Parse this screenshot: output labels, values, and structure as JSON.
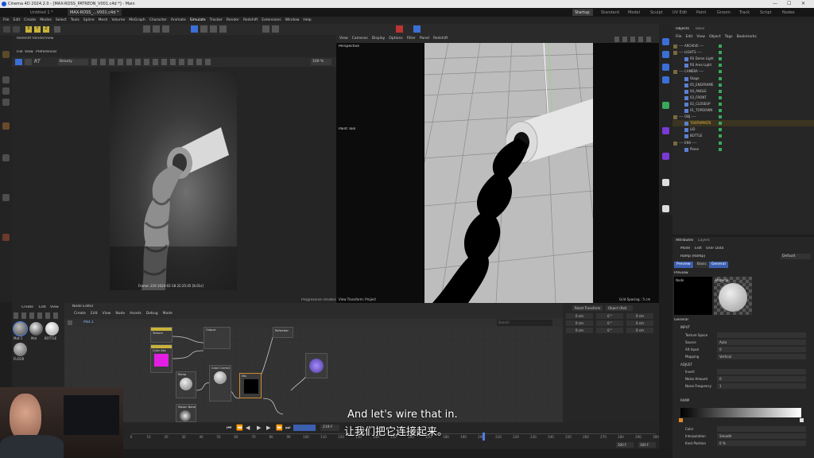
{
  "window": {
    "title": "Cinema 4D 2024.2.0 - [MAX-ROSS_PATREON_V001.c4d *] - Main",
    "doc_tabs": [
      "Untitled 1 *",
      "MAX-ROSS_...V001.c4d *"
    ]
  },
  "layouts": [
    "Startup",
    "Standard",
    "Model",
    "Sculpt",
    "UV Edit",
    "Paint",
    "Groom",
    "Track",
    "Script",
    "Nodes"
  ],
  "menu": [
    "File",
    "Edit",
    "Create",
    "Modes",
    "Select",
    "Tools",
    "Spline",
    "Mesh",
    "Volume",
    "MoGraph",
    "Character",
    "Animate",
    "Simulate",
    "Tracker",
    "Render",
    "Redshift",
    "Extensions",
    "Window",
    "Help"
  ],
  "axis_buttons": [
    "X",
    "Y",
    "Z"
  ],
  "render_view": {
    "title": "Redshift RenderView",
    "menu": [
      "File",
      "View",
      "Preferences"
    ],
    "beauty_select": "Beauty",
    "zoom": "100 %",
    "status": "Frame: 219 2024-02-18 22:25:45 [8.01s]",
    "progress_text": "Progressive rendering..."
  },
  "viewport": {
    "menu": [
      "View",
      "Cameras",
      "Display",
      "Options",
      "Filter",
      "Panel",
      "Redshift"
    ],
    "name": "Perspective",
    "tool": "Paint Tool",
    "grid": "Grid Spacing : 5 cm",
    "transform": "View Transform: Project"
  },
  "objects_panel": {
    "tabs": [
      "Objects",
      "Takes"
    ],
    "menu": [
      "File",
      "Edit",
      "View",
      "Object",
      "Tags",
      "Bookmarks"
    ],
    "items": [
      "---- ARCHIVE ----",
      "---- LIGHTS ----",
      "RS Dome Light",
      "RS Area Light",
      "---- CAMERA ----",
      "Stage",
      "05_ENDFRAME",
      "04_ANGLE",
      "03_FRONT",
      "02_CLOSEUP",
      "01_TOPDOWN",
      "---- OBJ ----",
      "TOOTHPASTE",
      "LID",
      "BOTTLE",
      "---- ENV ----",
      "Plane"
    ]
  },
  "attributes_panel": {
    "tabs": [
      "Attributes",
      "Layers"
    ],
    "menu": [
      "Mode",
      "Edit",
      "User Data"
    ],
    "object_name": "Ramp [Ramp]",
    "mode": "Default",
    "subtabs": [
      "Preview",
      "Basic",
      "General"
    ],
    "preview_label": "Preview",
    "node_label": "Node",
    "material_label": "Material",
    "general_label": "General",
    "input_label": "INPUT",
    "fields": [
      {
        "label": "Texture Space",
        "value": ""
      },
      {
        "label": "Source",
        "value": "Auto"
      },
      {
        "label": "Alt Input",
        "value": "0"
      },
      {
        "label": "Mapping",
        "value": "Vertical"
      }
    ],
    "adjust_label": "ADJUST",
    "adjust_fields": [
      {
        "label": "Invert",
        "value": ""
      },
      {
        "label": "Noise Amount",
        "value": "0"
      },
      {
        "label": "Noise Frequency",
        "value": "1"
      }
    ],
    "ramp_label": "RAMP",
    "bottom_fields": [
      {
        "label": "Color",
        "value": ""
      },
      {
        "label": "Interpolation",
        "value": "Smooth"
      },
      {
        "label": "Knot Position",
        "value": "0 %"
      }
    ]
  },
  "material_panel": {
    "menu": [
      "Create",
      "Edit",
      "View"
    ],
    "materials": [
      "Mat.1",
      "Mat",
      "BOTTLE",
      "FLOOR"
    ]
  },
  "node_editor": {
    "title": "Node Editor",
    "menu": [
      "Create",
      "Edit",
      "View",
      "Node",
      "Assets",
      "Debug",
      "Mode"
    ],
    "breadcrumb": "Mat.1",
    "search_placeholder": "Search",
    "nodes": [
      "Output",
      "Color Abs",
      "Texture",
      "Ramp",
      "Maxon Noise",
      "Color Correct",
      "Reflection",
      "Mix"
    ]
  },
  "coord_manager": {
    "reset": "Reset Transform",
    "object": "Object (Rel)",
    "rows": [
      [
        "0 cm",
        "0 °",
        "0 cm"
      ],
      [
        "0 cm",
        "0 °",
        "0 cm"
      ],
      [
        "0 cm",
        "0 °",
        "0 cm"
      ]
    ]
  },
  "timeline": {
    "current_frame": "219 F",
    "ticks": [
      "0",
      "10",
      "20",
      "30",
      "40",
      "50",
      "60",
      "70",
      "80",
      "90",
      "100",
      "110",
      "120",
      "130",
      "140",
      "150",
      "160",
      "170",
      "180",
      "190",
      "200",
      "210",
      "220",
      "230",
      "240",
      "250",
      "260",
      "270",
      "280",
      "290",
      "300"
    ],
    "end_frame": "300 F",
    "end_frame2": "300 F"
  },
  "subtitles": {
    "en": "And let's wire that in.",
    "zh": "让我们把它连接起来。"
  },
  "colors": {
    "accent": "#4d7ee8",
    "bg": "#1e1e1e",
    "panel": "#262626",
    "magenta": "#e31ee3",
    "yellow": "#c9b33a"
  }
}
